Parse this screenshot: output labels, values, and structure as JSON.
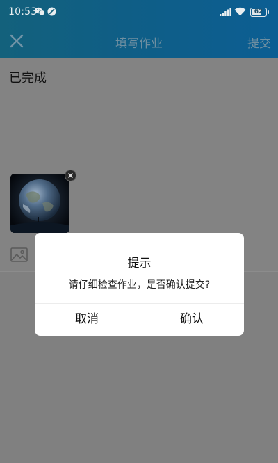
{
  "status_bar": {
    "time": "10:53",
    "battery_level": "62",
    "icons": [
      "wechat-icon",
      "do-not-disturb-icon",
      "signal-icon",
      "wifi-icon",
      "battery-icon"
    ]
  },
  "header": {
    "close_icon": "close-icon",
    "title": "填写作业",
    "submit_label": "提交"
  },
  "content": {
    "text": "已完成",
    "attachment_icon": "image-thumbnail",
    "remove_icon": "remove-icon",
    "tool_icon": "image-icon"
  },
  "dialog": {
    "title": "提示",
    "message": "请仔细检查作业，是否确认提交?",
    "cancel_label": "取消",
    "confirm_label": "确认"
  },
  "colors": {
    "header_gradient_start": "#13617c",
    "header_gradient_end": "#0c5e93",
    "overlay": "#808080",
    "dialog_bg": "#ffffff"
  }
}
